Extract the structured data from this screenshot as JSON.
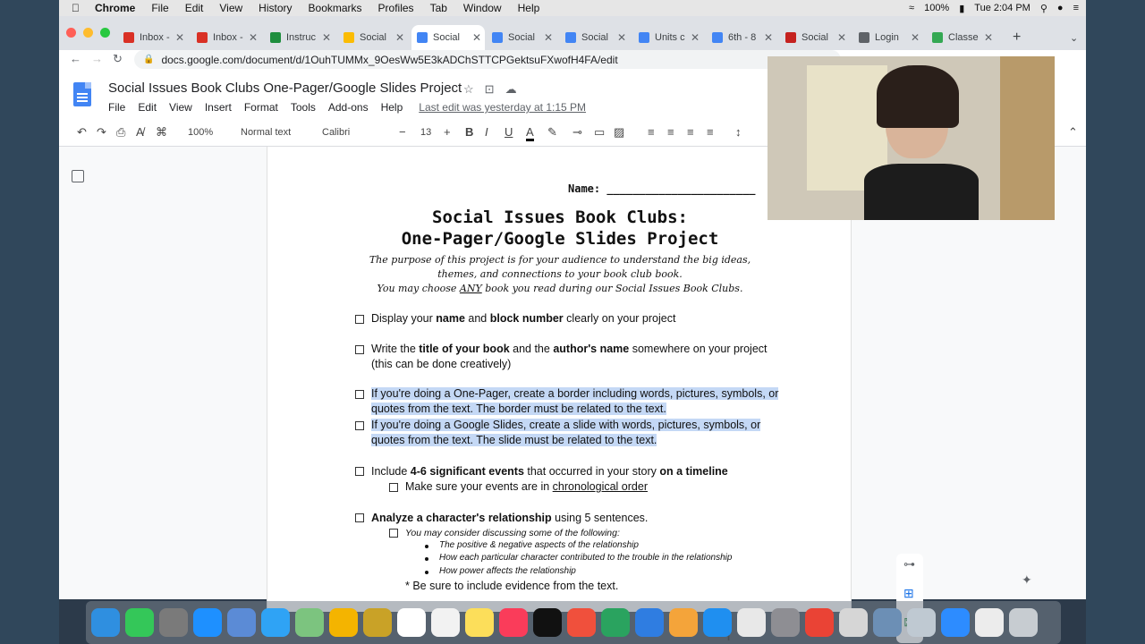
{
  "menubar": {
    "app": "Chrome",
    "items": [
      "File",
      "Edit",
      "View",
      "History",
      "Bookmarks",
      "Profiles",
      "Tab",
      "Window",
      "Help"
    ],
    "battery": "100%",
    "clock": "Tue 2:04 PM"
  },
  "tabs": [
    {
      "label": "Inbox -",
      "color": "#d93025"
    },
    {
      "label": "Inbox -",
      "color": "#d93025"
    },
    {
      "label": "Instruc",
      "color": "#1e8e3e"
    },
    {
      "label": "Social",
      "color": "#fbbc04"
    },
    {
      "label": "Social",
      "color": "#4285f4"
    },
    {
      "label": "Social",
      "color": "#4285f4"
    },
    {
      "label": "Social",
      "color": "#4285f4"
    },
    {
      "label": "Units c",
      "color": "#4285f4"
    },
    {
      "label": "6th - 8",
      "color": "#4285f4"
    },
    {
      "label": "Social",
      "color": "#c5221f"
    },
    {
      "label": "Login",
      "color": "#5f6368"
    },
    {
      "label": "Classe",
      "color": "#34a853"
    }
  ],
  "address": "docs.google.com/document/d/1OuhTUMMx_9OesWw5E3kADChSTTCPGektsuFXwofH4FA/edit",
  "doc": {
    "title": "Social Issues Book Clubs One-Pager/Google Slides Project",
    "menu": [
      "File",
      "Edit",
      "View",
      "Insert",
      "Format",
      "Tools",
      "Add-ons",
      "Help"
    ],
    "last_edit": "Last edit was yesterday at 1:15 PM",
    "zoom": "100%",
    "style": "Normal text",
    "font": "Calibri",
    "font_size": "13"
  },
  "content": {
    "name_line": "Name: _______________________",
    "title_line1": "Social Issues Book Clubs:",
    "title_line2": "One-Pager/Google Slides Project",
    "desc1": "The purpose of this project is for your audience to understand the big ideas,",
    "desc2": "themes, and connections to your book club book.",
    "desc3_a": "You may choose ",
    "desc3_any": "ANY",
    "desc3_b": " book you read during our Social Issues Book Clubs.",
    "item1": {
      "a": "Display your ",
      "b": "name",
      "c": " and ",
      "d": "block number",
      "e": " clearly on your project"
    },
    "item2": {
      "a": "Write the ",
      "b": "title of your book",
      "c": " and the ",
      "d": "author's name",
      "e": " somewhere on your project",
      "f": "(this can be done creatively)"
    },
    "item3": {
      "l1": "If you're doing a One-Pager, create a border including words, pictures, symbols, or",
      "l2": "quotes from the text. The border must be related to the text."
    },
    "item4": {
      "l1": "If you're doing a Google Slides, create a slide with words, pictures, symbols, or",
      "l2": "quotes from the text. The slide must be related to the text."
    },
    "item5": {
      "a": "Include ",
      "b": "4-6 significant events",
      "c": " that occurred in your story ",
      "d": "on a timeline"
    },
    "item5sub": {
      "a": "Make sure your events are in ",
      "b": "chronological order"
    },
    "item6": {
      "a": "Analyze a character's relationship",
      "b": " using 5 sentences."
    },
    "item6sub": "You may consider discussing some of the following:",
    "bullets": [
      "The positive & negative aspects of the relationship",
      "How each particular character contributed to the trouble in the relationship",
      "How power affects the relationship"
    ],
    "evidence": "* Be sure to include evidence from the text."
  }
}
